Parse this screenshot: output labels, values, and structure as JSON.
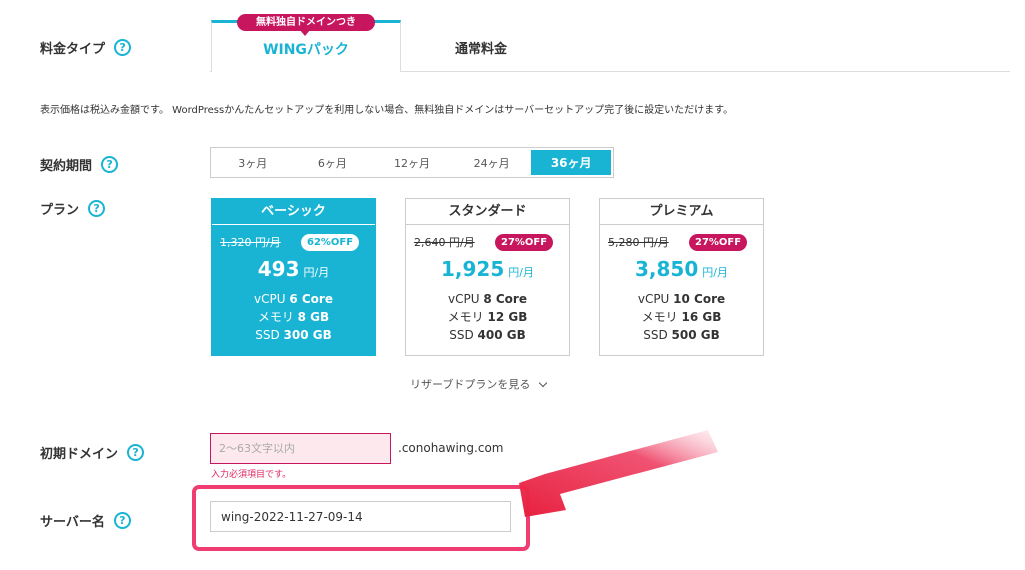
{
  "price_type": {
    "label": "料金タイプ",
    "help": "?"
  },
  "tabs": {
    "wing_badge": "無料独自ドメインつき",
    "wing": "WINGパック",
    "normal": "通常料金"
  },
  "notice": "表示価格は税込み金額です。 WordPressかんたんセットアップを利用しない場合、無料独自ドメインはサーバーセットアップ完了後に設定いただけます。",
  "period": {
    "label": "契約期間",
    "help": "?",
    "options": [
      "3ヶ月",
      "6ヶ月",
      "12ヶ月",
      "24ヶ月",
      "36ヶ月"
    ],
    "selected": "36ヶ月"
  },
  "plan": {
    "label": "プラン",
    "help": "?",
    "cards": [
      {
        "name": "ベーシック",
        "old_price": "1,320 円/月",
        "discount": "62%OFF",
        "price": "493",
        "unit": "円/月",
        "vcpu_label": "vCPU",
        "vcpu": "6 Core",
        "mem_label": "メモリ",
        "mem": "8 GB",
        "ssd_label": "SSD",
        "ssd": "300 GB",
        "selected": true
      },
      {
        "name": "スタンダード",
        "old_price": "2,640 円/月",
        "discount": "27%OFF",
        "price": "1,925",
        "unit": "円/月",
        "vcpu_label": "vCPU",
        "vcpu": "8 Core",
        "mem_label": "メモリ",
        "mem": "12 GB",
        "ssd_label": "SSD",
        "ssd": "400 GB",
        "selected": false
      },
      {
        "name": "プレミアム",
        "old_price": "5,280 円/月",
        "discount": "27%OFF",
        "price": "3,850",
        "unit": "円/月",
        "vcpu_label": "vCPU",
        "vcpu": "10 Core",
        "mem_label": "メモリ",
        "mem": "16 GB",
        "ssd_label": "SSD",
        "ssd": "500 GB",
        "selected": false
      }
    ],
    "reserve_link": "リザーブドプランを見る"
  },
  "domain": {
    "label": "初期ドメイン",
    "help": "?",
    "placeholder": "2〜63文字以内",
    "value": "",
    "suffix": ".conohawing.com",
    "error": "入力必須項目です。"
  },
  "server_name": {
    "label": "サーバー名",
    "help": "?",
    "value": "wing-2022-11-27-09-14"
  },
  "colors": {
    "accent": "#19b4d4",
    "badge": "#c7155e",
    "highlight": "#ef3d72",
    "arrow": "#e8203f"
  }
}
